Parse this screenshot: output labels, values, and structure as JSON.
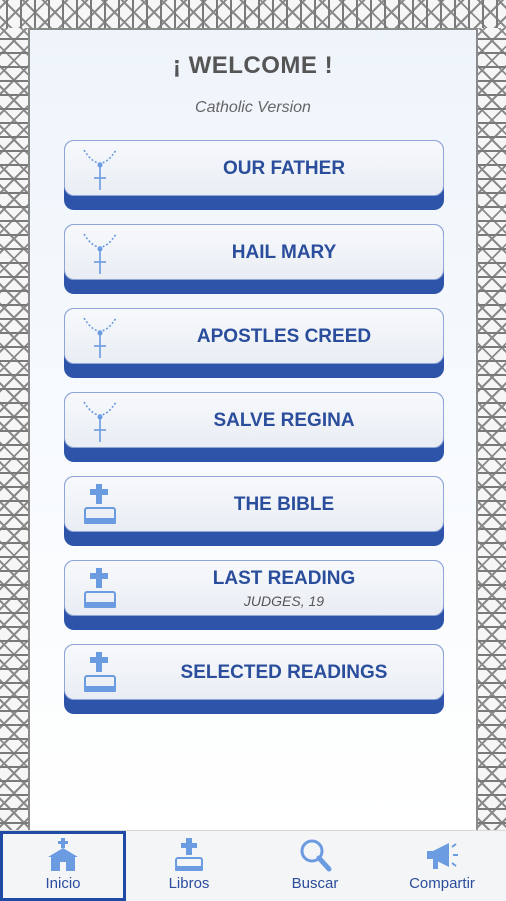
{
  "header": {
    "title": "¡ WELCOME !",
    "subtitle": "Catholic Version"
  },
  "menu": [
    {
      "label": "OUR FATHER",
      "icon": "rosary-icon"
    },
    {
      "label": "HAIL MARY",
      "icon": "rosary-icon"
    },
    {
      "label": "APOSTLES CREED",
      "icon": "rosary-icon"
    },
    {
      "label": "SALVE REGINA",
      "icon": "rosary-icon"
    },
    {
      "label": "THE BIBLE",
      "icon": "bible-icon"
    },
    {
      "label": "LAST READING",
      "sub": "JUDGES, 19",
      "icon": "bible-icon"
    },
    {
      "label": "SELECTED READINGS",
      "icon": "bible-icon"
    }
  ],
  "nav": [
    {
      "label": "Inicio",
      "icon": "church-icon",
      "active": true
    },
    {
      "label": "Libros",
      "icon": "bible-icon",
      "active": false
    },
    {
      "label": "Buscar",
      "icon": "search-icon",
      "active": false
    },
    {
      "label": "Compartir",
      "icon": "megaphone-icon",
      "active": false
    }
  ],
  "colors": {
    "accent": "#2d54a8",
    "text_blue": "#2a4d9c",
    "icon_blue": "#6b9be0"
  }
}
